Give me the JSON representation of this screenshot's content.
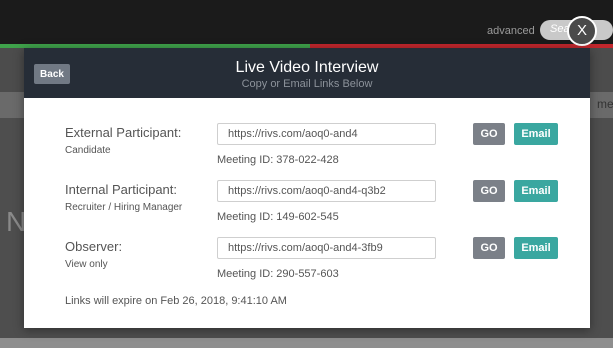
{
  "background": {
    "search_placeholder": "Search",
    "advanced_label": "advanced",
    "letter_n": "N",
    "clip_text": "me"
  },
  "close": {
    "label": "X"
  },
  "modal": {
    "back_label": "Back",
    "title": "Live Video Interview",
    "subtitle": "Copy or Email Links Below",
    "participants": [
      {
        "title": "External Participant:",
        "subtitle": "Candidate",
        "link": "https://rivs.com/aoq0-and4",
        "meeting_id": "Meeting ID: 378-022-428",
        "go_label": "GO",
        "email_label": "Email"
      },
      {
        "title": "Internal Participant:",
        "subtitle": "Recruiter / Hiring Manager",
        "link": "https://rivs.com/aoq0-and4-q3b2",
        "meeting_id": "Meeting ID: 149-602-545",
        "go_label": "GO",
        "email_label": "Email"
      },
      {
        "title": "Observer:",
        "subtitle": "View only",
        "link": "https://rivs.com/aoq0-and4-3fb9",
        "meeting_id": "Meeting ID: 290-557-603",
        "go_label": "GO",
        "email_label": "Email"
      }
    ],
    "expiry": "Links will expire on Feb 26, 2018, 9:41:10 AM"
  },
  "colors": {
    "header_bg": "#262d37",
    "go_button": "#7b8088",
    "email_button": "#3aa7a0",
    "accent_green": "#3fa24b",
    "accent_red": "#c2272d"
  }
}
